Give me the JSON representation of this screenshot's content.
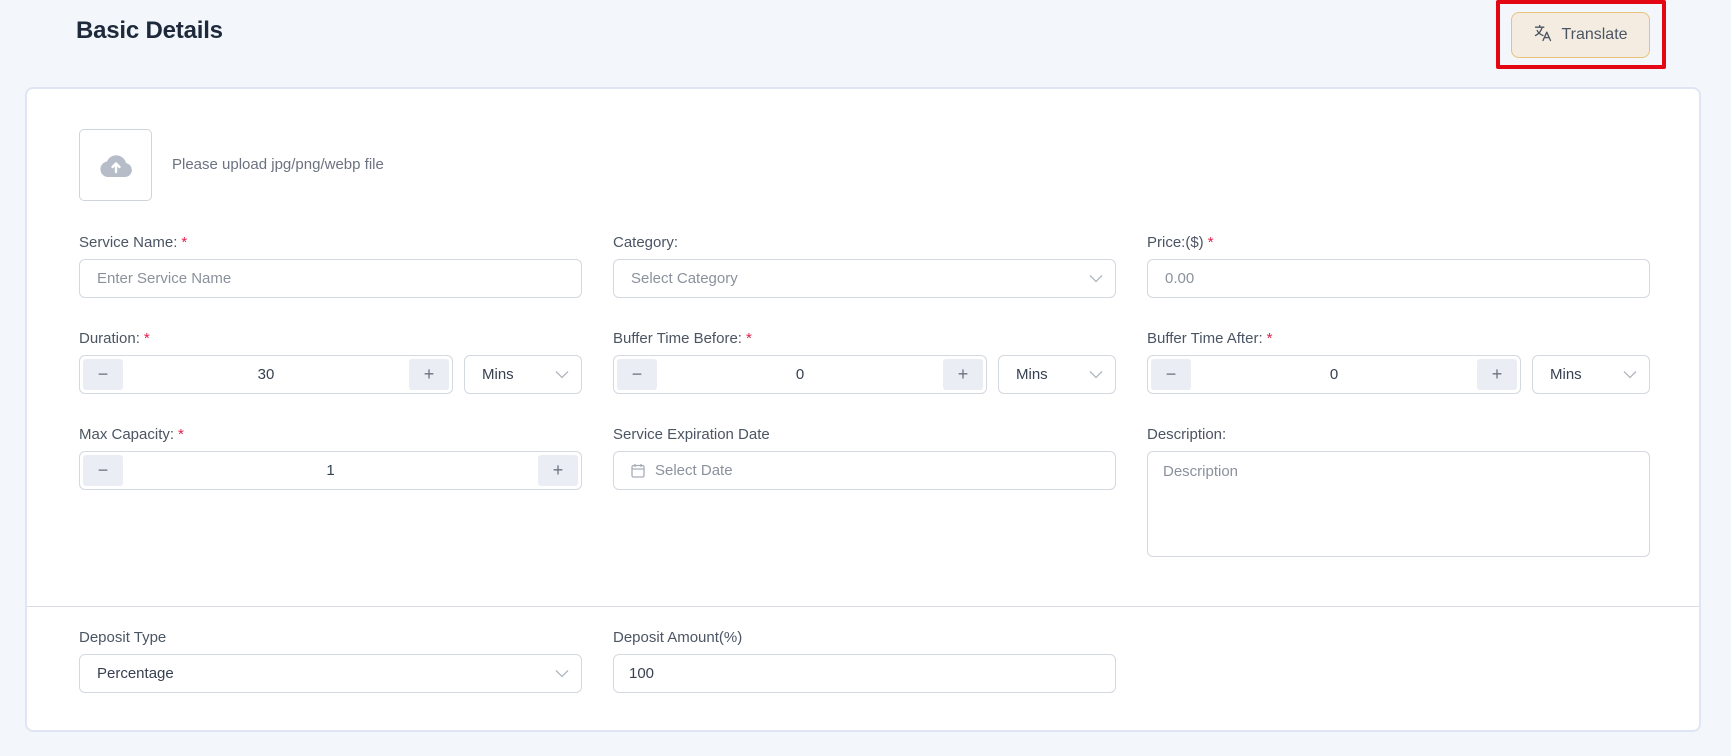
{
  "header": {
    "title": "Basic Details",
    "translate_label": "Translate"
  },
  "upload": {
    "hint": "Please upload jpg/png/webp file"
  },
  "fields": {
    "service_name": {
      "label": "Service Name:",
      "required": "*",
      "placeholder": "Enter Service Name",
      "value": ""
    },
    "category": {
      "label": "Category:",
      "placeholder": "Select Category",
      "value": ""
    },
    "price": {
      "label": "Price:($)",
      "required": "*",
      "placeholder": "0.00",
      "value": ""
    },
    "duration": {
      "label": "Duration:",
      "required": "*",
      "value": "30",
      "unit": "Mins",
      "decrement": "−",
      "increment": "+"
    },
    "buffer_before": {
      "label": "Buffer Time Before:",
      "required": "*",
      "value": "0",
      "unit": "Mins",
      "decrement": "−",
      "increment": "+"
    },
    "buffer_after": {
      "label": "Buffer Time After:",
      "required": "*",
      "value": "0",
      "unit": "Mins",
      "decrement": "−",
      "increment": "+"
    },
    "max_capacity": {
      "label": "Max Capacity:",
      "required": "*",
      "value": "1",
      "decrement": "−",
      "increment": "+"
    },
    "expiration_date": {
      "label": "Service Expiration Date",
      "placeholder": "Select Date",
      "value": ""
    },
    "description": {
      "label": "Description:",
      "placeholder": "Description",
      "value": ""
    },
    "deposit_type": {
      "label": "Deposit Type",
      "value": "Percentage"
    },
    "deposit_amount": {
      "label": "Deposit Amount(%)",
      "value": "100"
    }
  },
  "colors": {
    "background": "#f3f7fb",
    "required_asterisk": "#e11d48",
    "translate_bg": "#f5ece1",
    "translate_border": "#e8c27a",
    "highlight_box": "#e30613"
  }
}
